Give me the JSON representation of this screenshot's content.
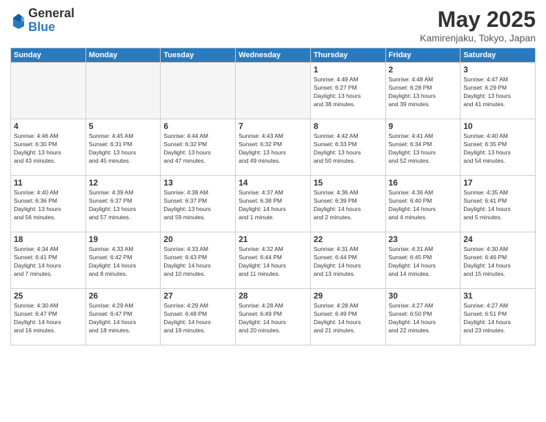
{
  "header": {
    "logo_general": "General",
    "logo_blue": "Blue",
    "month": "May 2025",
    "location": "Kamirenjaku, Tokyo, Japan"
  },
  "weekdays": [
    "Sunday",
    "Monday",
    "Tuesday",
    "Wednesday",
    "Thursday",
    "Friday",
    "Saturday"
  ],
  "weeks": [
    [
      {
        "day": "",
        "info": ""
      },
      {
        "day": "",
        "info": ""
      },
      {
        "day": "",
        "info": ""
      },
      {
        "day": "",
        "info": ""
      },
      {
        "day": "1",
        "info": "Sunrise: 4:49 AM\nSunset: 6:27 PM\nDaylight: 13 hours\nand 38 minutes."
      },
      {
        "day": "2",
        "info": "Sunrise: 4:48 AM\nSunset: 6:28 PM\nDaylight: 13 hours\nand 39 minutes."
      },
      {
        "day": "3",
        "info": "Sunrise: 4:47 AM\nSunset: 6:29 PM\nDaylight: 13 hours\nand 41 minutes."
      }
    ],
    [
      {
        "day": "4",
        "info": "Sunrise: 4:46 AM\nSunset: 6:30 PM\nDaylight: 13 hours\nand 43 minutes."
      },
      {
        "day": "5",
        "info": "Sunrise: 4:45 AM\nSunset: 6:31 PM\nDaylight: 13 hours\nand 45 minutes."
      },
      {
        "day": "6",
        "info": "Sunrise: 4:44 AM\nSunset: 6:32 PM\nDaylight: 13 hours\nand 47 minutes."
      },
      {
        "day": "7",
        "info": "Sunrise: 4:43 AM\nSunset: 6:32 PM\nDaylight: 13 hours\nand 49 minutes."
      },
      {
        "day": "8",
        "info": "Sunrise: 4:42 AM\nSunset: 6:33 PM\nDaylight: 13 hours\nand 50 minutes."
      },
      {
        "day": "9",
        "info": "Sunrise: 4:41 AM\nSunset: 6:34 PM\nDaylight: 13 hours\nand 52 minutes."
      },
      {
        "day": "10",
        "info": "Sunrise: 4:40 AM\nSunset: 6:35 PM\nDaylight: 13 hours\nand 54 minutes."
      }
    ],
    [
      {
        "day": "11",
        "info": "Sunrise: 4:40 AM\nSunset: 6:36 PM\nDaylight: 13 hours\nand 56 minutes."
      },
      {
        "day": "12",
        "info": "Sunrise: 4:39 AM\nSunset: 6:37 PM\nDaylight: 13 hours\nand 57 minutes."
      },
      {
        "day": "13",
        "info": "Sunrise: 4:38 AM\nSunset: 6:37 PM\nDaylight: 13 hours\nand 59 minutes."
      },
      {
        "day": "14",
        "info": "Sunrise: 4:37 AM\nSunset: 6:38 PM\nDaylight: 14 hours\nand 1 minute."
      },
      {
        "day": "15",
        "info": "Sunrise: 4:36 AM\nSunset: 6:39 PM\nDaylight: 14 hours\nand 2 minutes."
      },
      {
        "day": "16",
        "info": "Sunrise: 4:36 AM\nSunset: 6:40 PM\nDaylight: 14 hours\nand 4 minutes."
      },
      {
        "day": "17",
        "info": "Sunrise: 4:35 AM\nSunset: 6:41 PM\nDaylight: 14 hours\nand 5 minutes."
      }
    ],
    [
      {
        "day": "18",
        "info": "Sunrise: 4:34 AM\nSunset: 6:41 PM\nDaylight: 14 hours\nand 7 minutes."
      },
      {
        "day": "19",
        "info": "Sunrise: 4:33 AM\nSunset: 6:42 PM\nDaylight: 14 hours\nand 8 minutes."
      },
      {
        "day": "20",
        "info": "Sunrise: 4:33 AM\nSunset: 6:43 PM\nDaylight: 14 hours\nand 10 minutes."
      },
      {
        "day": "21",
        "info": "Sunrise: 4:32 AM\nSunset: 6:44 PM\nDaylight: 14 hours\nand 11 minutes."
      },
      {
        "day": "22",
        "info": "Sunrise: 4:31 AM\nSunset: 6:44 PM\nDaylight: 14 hours\nand 13 minutes."
      },
      {
        "day": "23",
        "info": "Sunrise: 4:31 AM\nSunset: 6:45 PM\nDaylight: 14 hours\nand 14 minutes."
      },
      {
        "day": "24",
        "info": "Sunrise: 4:30 AM\nSunset: 6:46 PM\nDaylight: 14 hours\nand 15 minutes."
      }
    ],
    [
      {
        "day": "25",
        "info": "Sunrise: 4:30 AM\nSunset: 6:47 PM\nDaylight: 14 hours\nand 16 minutes."
      },
      {
        "day": "26",
        "info": "Sunrise: 4:29 AM\nSunset: 6:47 PM\nDaylight: 14 hours\nand 18 minutes."
      },
      {
        "day": "27",
        "info": "Sunrise: 4:29 AM\nSunset: 6:48 PM\nDaylight: 14 hours\nand 19 minutes."
      },
      {
        "day": "28",
        "info": "Sunrise: 4:28 AM\nSunset: 6:49 PM\nDaylight: 14 hours\nand 20 minutes."
      },
      {
        "day": "29",
        "info": "Sunrise: 4:28 AM\nSunset: 6:49 PM\nDaylight: 14 hours\nand 21 minutes."
      },
      {
        "day": "30",
        "info": "Sunrise: 4:27 AM\nSunset: 6:50 PM\nDaylight: 14 hours\nand 22 minutes."
      },
      {
        "day": "31",
        "info": "Sunrise: 4:27 AM\nSunset: 6:51 PM\nDaylight: 14 hours\nand 23 minutes."
      }
    ]
  ]
}
